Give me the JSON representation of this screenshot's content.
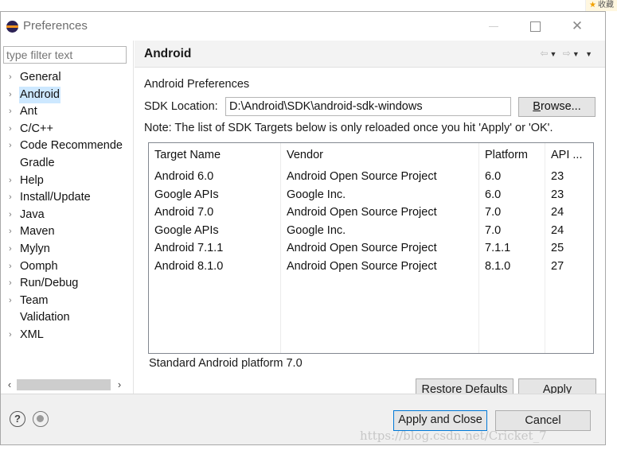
{
  "page_badge": {
    "label": "收藏"
  },
  "window": {
    "title": "Preferences"
  },
  "filter": {
    "placeholder": "type filter text"
  },
  "tree": {
    "items": [
      {
        "label": "General",
        "arrow": "›"
      },
      {
        "label": "Android",
        "arrow": "›",
        "selected": true
      },
      {
        "label": "Ant",
        "arrow": "›"
      },
      {
        "label": "C/C++",
        "arrow": "›"
      },
      {
        "label": "Code Recommende",
        "arrow": "›"
      },
      {
        "label": "Gradle",
        "arrow": ""
      },
      {
        "label": "Help",
        "arrow": "›"
      },
      {
        "label": "Install/Update",
        "arrow": "›"
      },
      {
        "label": "Java",
        "arrow": "›"
      },
      {
        "label": "Maven",
        "arrow": "›"
      },
      {
        "label": "Mylyn",
        "arrow": "›"
      },
      {
        "label": "Oomph",
        "arrow": "›"
      },
      {
        "label": "Run/Debug",
        "arrow": "›"
      },
      {
        "label": "Team",
        "arrow": "›"
      },
      {
        "label": "Validation",
        "arrow": ""
      },
      {
        "label": "XML",
        "arrow": "›"
      }
    ]
  },
  "page": {
    "title": "Android",
    "heading": "Android Preferences",
    "sdk_label": "SDK Location:",
    "sdk_value": "D:\\Android\\SDK\\android-sdk-windows",
    "browse_pre": "",
    "browse_mnemonic": "B",
    "browse_post": "rowse...",
    "note": "Note: The list of SDK Targets below is only reloaded once you hit 'Apply' or 'OK'.",
    "status": "Standard Android platform 7.0"
  },
  "table": {
    "headers": [
      "Target Name",
      "Vendor",
      "Platform",
      "API ..."
    ],
    "rows": [
      [
        "Android 6.0",
        "Android Open Source Project",
        "6.0",
        "23"
      ],
      [
        "Google APIs",
        "Google Inc.",
        "6.0",
        "23"
      ],
      [
        "Android 7.0",
        "Android Open Source Project",
        "7.0",
        "24"
      ],
      [
        "Google APIs",
        "Google Inc.",
        "7.0",
        "24"
      ],
      [
        "Android 7.1.1",
        "Android Open Source Project",
        "7.1.1",
        "25"
      ],
      [
        "Android 8.1.0",
        "Android Open Source Project",
        "8.1.0",
        "27"
      ]
    ]
  },
  "buttons": {
    "restore_pre": "Restore ",
    "restore_mnemonic": "D",
    "restore_post": "efaults",
    "apply_pre": "",
    "apply_mnemonic": "A",
    "apply_post": "pply",
    "apply_close": "Apply and Close",
    "cancel": "Cancel"
  },
  "icons": {
    "app": "eclipse-icon",
    "help": "help-icon",
    "record": "record-icon"
  },
  "colors": {
    "selection": "#cde8ff",
    "default_button_border": "#0078d7"
  },
  "watermark": "https://blog.csdn.net/Cricket_7"
}
